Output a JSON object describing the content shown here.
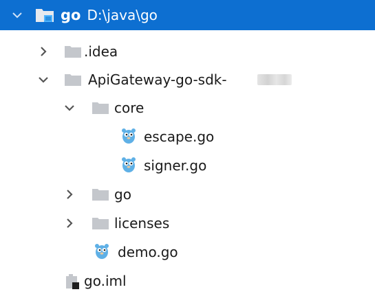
{
  "tree": {
    "root": {
      "name": "go",
      "path": "D:\\java\\go",
      "icon": "module-folder-icon",
      "expanded": true
    },
    "items": [
      {
        "label": ".idea",
        "icon": "folder-icon",
        "expanded": false
      },
      {
        "label": "ApiGateway-go-sdk-",
        "icon": "folder-icon",
        "expanded": true,
        "redacted_suffix": true
      },
      {
        "label": "core",
        "icon": "folder-icon",
        "expanded": true
      },
      {
        "label": "escape.go",
        "icon": "gopher-file-icon"
      },
      {
        "label": "signer.go",
        "icon": "gopher-file-icon"
      },
      {
        "label": "go",
        "icon": "folder-icon",
        "expanded": false
      },
      {
        "label": "licenses",
        "icon": "folder-icon",
        "expanded": false
      },
      {
        "label": "demo.go",
        "icon": "gopher-file-icon"
      },
      {
        "label": "go.iml",
        "icon": "iml-file-icon"
      }
    ]
  },
  "colors": {
    "selection": "#0d6fd1",
    "folder": "#c4c7cc",
    "text": "#1a1a1a",
    "chevron": "#555555",
    "gopher": "#5fb0e6"
  }
}
